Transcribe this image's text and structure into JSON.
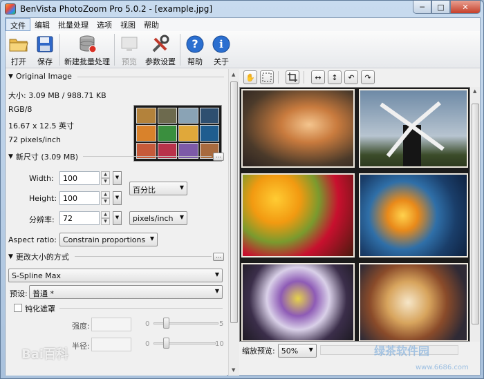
{
  "window": {
    "title": "BenVista PhotoZoom Pro 5.0.2 - [example.jpg]",
    "controls": {
      "minimize": "─",
      "maximize": "□",
      "close": "✕"
    }
  },
  "menu": [
    "文件",
    "编辑",
    "批量处理",
    "选项",
    "视图",
    "帮助"
  ],
  "toolbar": {
    "open": "打开",
    "save": "保存",
    "new_batch": "新建批量处理",
    "preview": "预览",
    "settings": "参数设置",
    "help": "帮助",
    "about": "关于"
  },
  "original_image": {
    "header": "Original Image",
    "size": "大小: 3.09 MB / 988.71 KB",
    "mode": "RGB/8",
    "dimensions": "16.67 x 12.5 英寸",
    "resolution": "72 pixels/inch"
  },
  "new_size": {
    "header": "新尺寸 (3.09 MB)",
    "more": "...",
    "width_label": "Width:",
    "width_value": "100",
    "height_label": "Height:",
    "height_value": "100",
    "unit": "百分比",
    "resolution_label": "分辨率:",
    "resolution_value": "72",
    "resolution_unit": "pixels/inch",
    "aspect_label": "Aspect ratio:",
    "aspect_value": "Constrain proportions"
  },
  "resize_method": {
    "header": "更改大小的方式",
    "more": "...",
    "method": "S-Spline Max",
    "preset_label": "预设:",
    "preset_value": "普通 *"
  },
  "unsharp": {
    "label": "钝化遮罩",
    "checked": false,
    "strength_label": "强度:",
    "strength_min": "0",
    "strength_max": "5",
    "radius_label": "半径:",
    "radius_min": "0",
    "radius_max": "10"
  },
  "preview": {
    "zoom_label": "缩放预览:",
    "zoom_value": "50%"
  },
  "watermarks": {
    "left": "Bai百科",
    "right": "绿茶软件园",
    "url": "www.6686.com"
  },
  "colors": {
    "accent_blue": "#2b6fd0",
    "window_frame": "#a9c1dc"
  }
}
